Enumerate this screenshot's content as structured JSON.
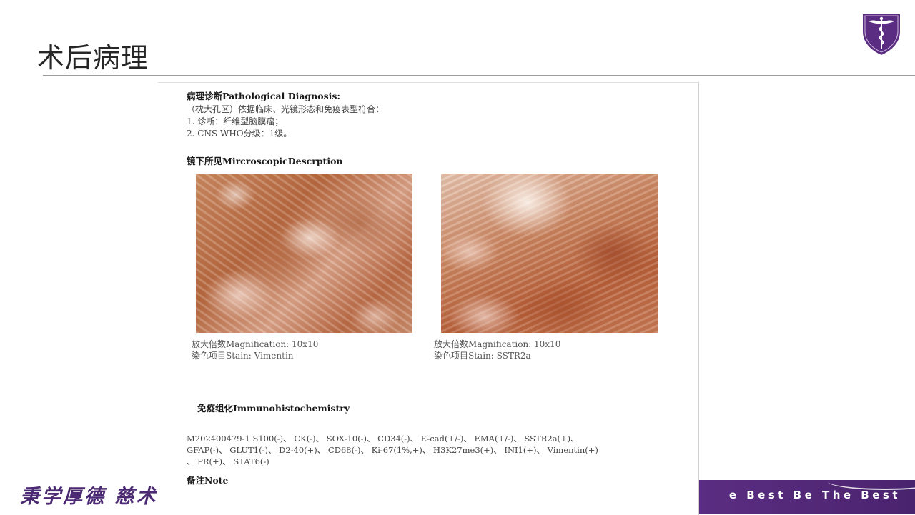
{
  "slide": {
    "title": "术后病理",
    "footer_left": "秉学厚德 慈术",
    "footer_right": "e Best  Be The Best"
  },
  "logo": {
    "name": "caduceus-shield-logo",
    "colors": {
      "shield": "#5b2d82",
      "accent": "#ffffff"
    }
  },
  "report": {
    "diagnosis_heading": "病理诊断Pathological Diagnosis:",
    "diagnosis_lines": [
      "（枕大孔区）依据临床、光镜形态和免疫表型符合：",
      "1. 诊断：纤维型脑膜瘤；",
      "2. CNS WHO分级：1级。"
    ],
    "microscopic_heading": "镜下所见MircroscopicDescrption",
    "images": [
      {
        "magnification": "放大倍数Magnification: 10x10",
        "stain": "染色项目Stain: Vimentin"
      },
      {
        "magnification": "放大倍数Magnification: 10x10",
        "stain": "染色项目Stain: SSTR2a"
      }
    ],
    "ihc_heading": "免疫组化Immunohistochemistry",
    "ihc_lines": [
      "M202400479-1  S100(-)、 CK(-)、 SOX-10(-)、 CD34(-)、 E-cad(+/-)、 EMA(+/-)、 SSTR2a(+)、",
      "GFAP(-)、 GLUT1(-)、 D2-40(+)、 CD68(-)、 Ki-67(1%,+)、 H3K27me3(+)、 INI1(+)、 Vimentin(+)",
      "、 PR(+)、 STAT6(-)"
    ],
    "note_label": "备注Note"
  },
  "colors": {
    "brand_purple": "#5b2d82",
    "title_text": "#262626",
    "rule": "#9c9c9c"
  }
}
